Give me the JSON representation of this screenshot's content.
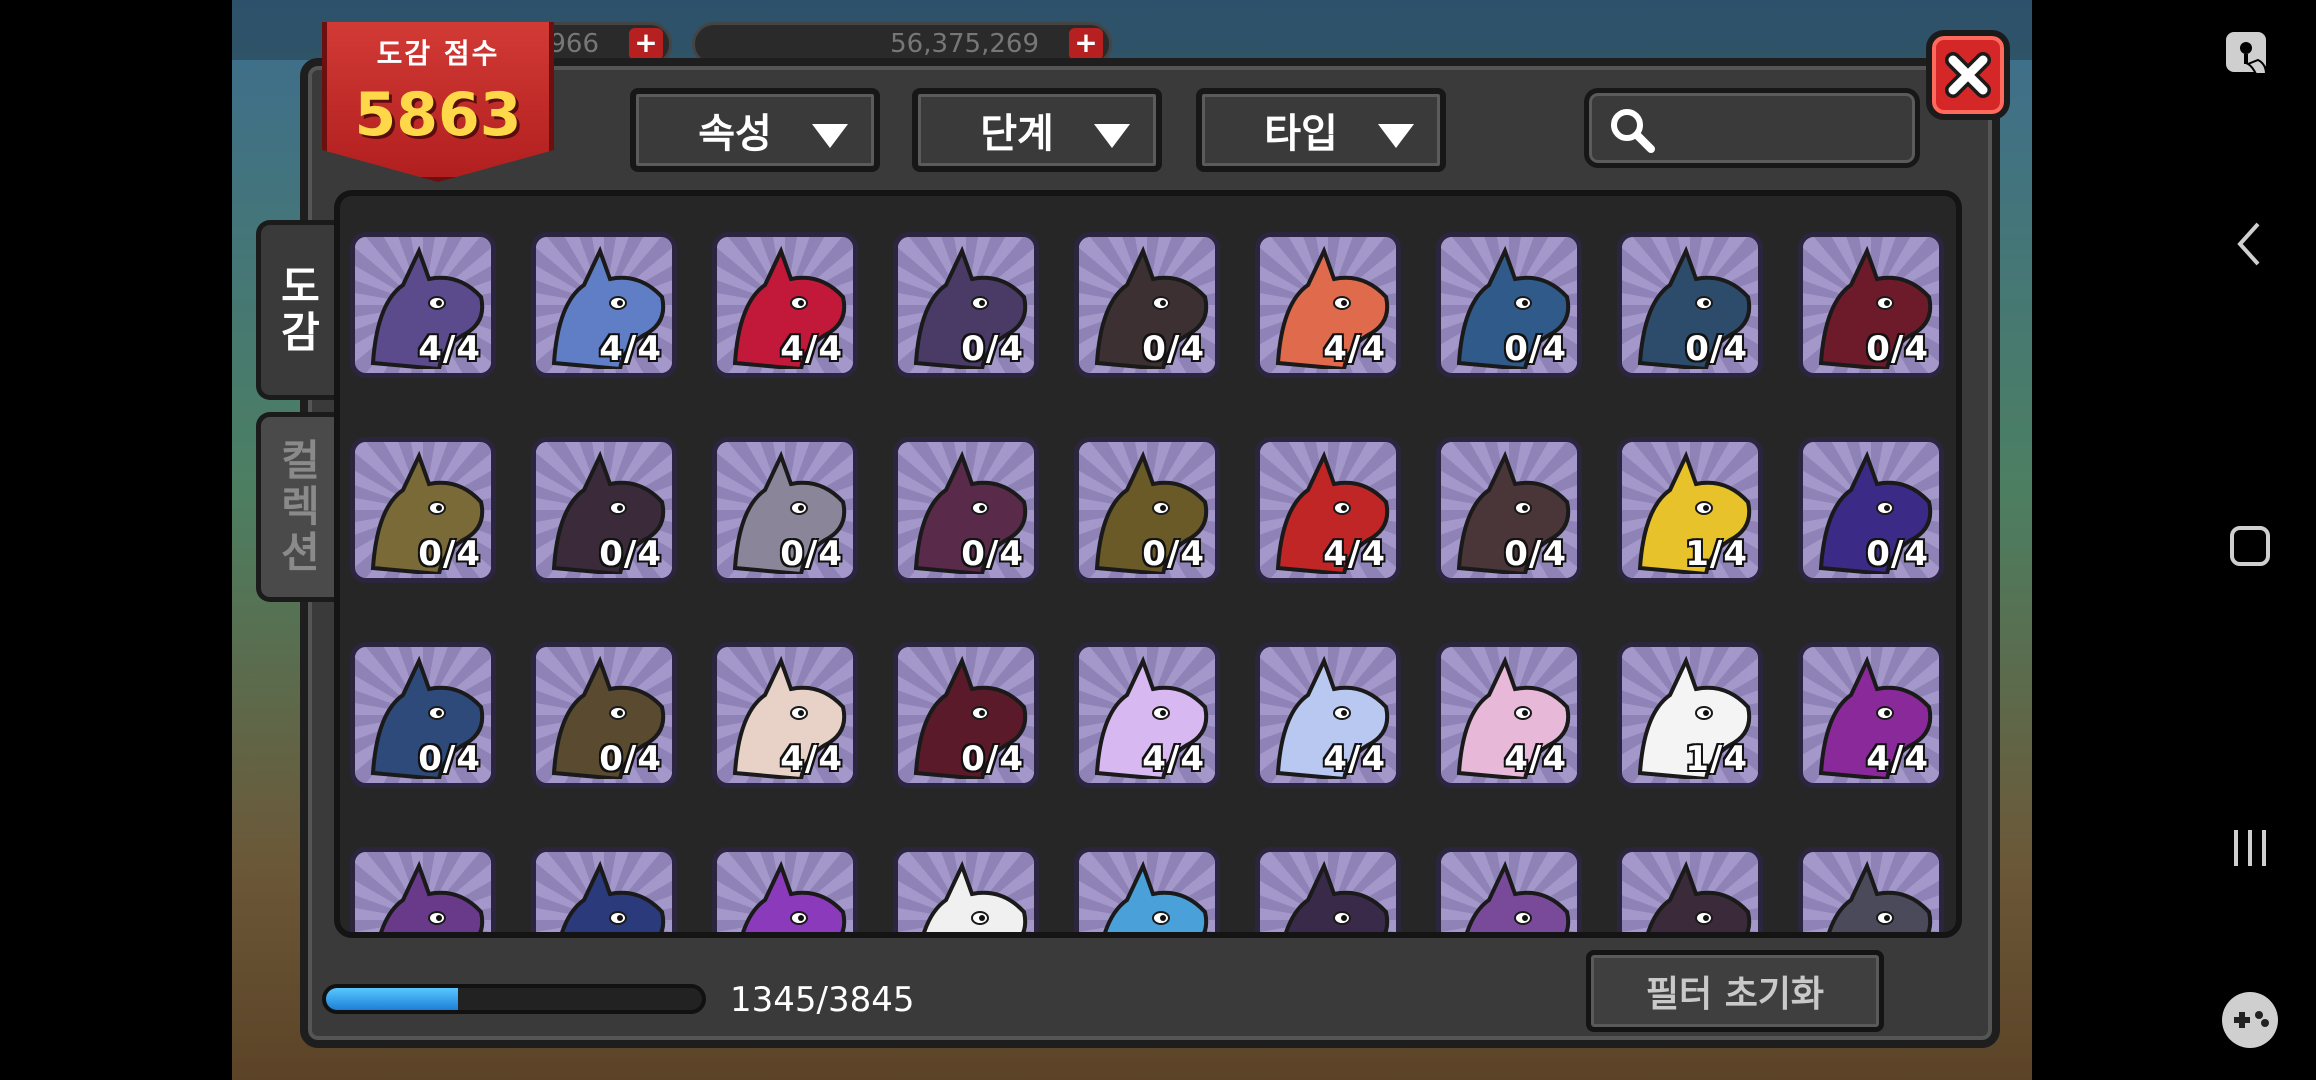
{
  "hud": {
    "pill_gems": "966",
    "pill_gold": "56,375,269"
  },
  "score": {
    "title": "도감 점수",
    "value": "5863"
  },
  "filters": [
    {
      "label": "속성",
      "icon": "dropdown-triangle"
    },
    {
      "label": "단계",
      "icon": "dropdown-triangle"
    },
    {
      "label": "타입",
      "icon": "dropdown-triangle"
    }
  ],
  "search": {
    "placeholder": "",
    "value": "",
    "icon": "search-icon"
  },
  "close": {
    "icon": "close-x-icon"
  },
  "tabs": [
    {
      "label": "도감",
      "active": true
    },
    {
      "label": "컬렉션",
      "active": false
    }
  ],
  "cards": [
    {
      "count": "4/4",
      "color": "#5b4a8c"
    },
    {
      "count": "4/4",
      "color": "#5f7ec6"
    },
    {
      "count": "4/4",
      "color": "#c2183a"
    },
    {
      "count": "0/4",
      "color": "#4a3a66"
    },
    {
      "count": "0/4",
      "color": "#3d3033"
    },
    {
      "count": "4/4",
      "color": "#e06a4c"
    },
    {
      "count": "0/4",
      "color": "#2f5a8a"
    },
    {
      "count": "0/4",
      "color": "#2d4c6b"
    },
    {
      "count": "0/4",
      "color": "#6d1a2a"
    },
    {
      "count": "0/4",
      "color": "#7a6a38"
    },
    {
      "count": "0/4",
      "color": "#3a2a3a"
    },
    {
      "count": "0/4",
      "color": "#8a8598"
    },
    {
      "count": "0/4",
      "color": "#5a2a4a"
    },
    {
      "count": "0/4",
      "color": "#6a5a28"
    },
    {
      "count": "4/4",
      "color": "#c02626"
    },
    {
      "count": "0/4",
      "color": "#4a3538"
    },
    {
      "count": "1/4",
      "color": "#e8c22a"
    },
    {
      "count": "0/4",
      "color": "#3b2a86"
    },
    {
      "count": "0/4",
      "color": "#2d4a7a"
    },
    {
      "count": "0/4",
      "color": "#5a4a30"
    },
    {
      "count": "4/4",
      "color": "#e8d2c8"
    },
    {
      "count": "0/4",
      "color": "#5a1a2a"
    },
    {
      "count": "4/4",
      "color": "#d8b8f0"
    },
    {
      "count": "4/4",
      "color": "#b8c8f0"
    },
    {
      "count": "4/4",
      "color": "#e8b8d8"
    },
    {
      "count": "1/4",
      "color": "#f4f4f4"
    },
    {
      "count": "4/4",
      "color": "#8a2a9a"
    },
    {
      "count": "",
      "color": "#6a3a8a"
    },
    {
      "count": "",
      "color": "#2a3a7a"
    },
    {
      "count": "",
      "color": "#8a3aba"
    },
    {
      "count": "",
      "color": "#f0f0f0"
    },
    {
      "count": "",
      "color": "#4aa0d8"
    },
    {
      "count": "",
      "color": "#3a2a4a"
    },
    {
      "count": "",
      "color": "#7a4a9a"
    },
    {
      "count": "",
      "color": "#3a2a3a"
    },
    {
      "count": "",
      "color": "#4a4a5a"
    }
  ],
  "progress": {
    "text": "1345/3845",
    "fraction": 0.35
  },
  "reset_button": {
    "label": "필터 초기화"
  },
  "nav": {
    "icons": [
      "pin-touch-icon",
      "back-icon",
      "home-icon",
      "recents-icon",
      "game-tools-icon"
    ]
  }
}
